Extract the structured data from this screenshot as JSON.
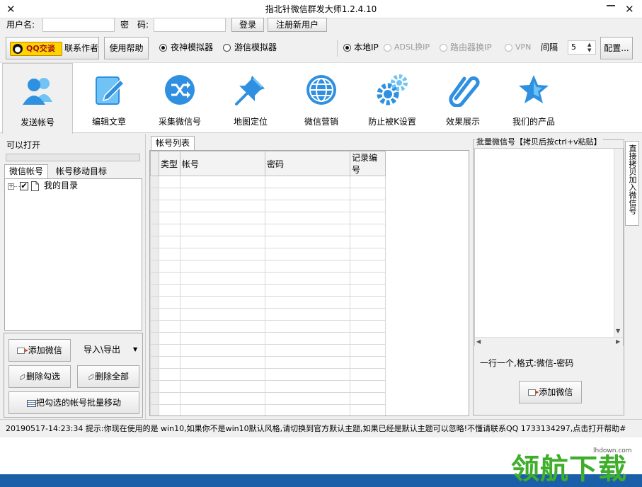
{
  "window": {
    "title": "指北针微信群发大师1.2.4.10"
  },
  "login": {
    "username_label": "用户名:",
    "password_label": "密　码:",
    "username_value": "",
    "password_value": "",
    "login_button": "登录",
    "register_button": "注册新用户"
  },
  "options": {
    "qq_button": "QQ交谈",
    "contact_author": "联系作者",
    "help_button": "使用帮助",
    "emulators": [
      {
        "label": "夜神模拟器",
        "selected": true
      },
      {
        "label": "游信模拟器",
        "selected": false
      }
    ],
    "ip_modes": [
      {
        "label": "本地IP",
        "selected": true,
        "enabled": true
      },
      {
        "label": "ADSL换IP",
        "selected": false,
        "enabled": false
      },
      {
        "label": "路由器换IP",
        "selected": false,
        "enabled": false
      },
      {
        "label": "VPN",
        "selected": false,
        "enabled": false
      }
    ],
    "interval_label": "间隔",
    "interval_value": "5",
    "config_button": "配置..."
  },
  "toolbar": {
    "items": [
      {
        "label": "发送帐号",
        "icon": "users-icon",
        "active": true
      },
      {
        "label": "编辑文章",
        "icon": "edit-icon",
        "active": false
      },
      {
        "label": "采集微信号",
        "icon": "shuffle-icon",
        "active": false
      },
      {
        "label": "地图定位",
        "icon": "pushpin-icon",
        "active": false
      },
      {
        "label": "微信营销",
        "icon": "globe-icon",
        "active": false
      },
      {
        "label": "防止被K设置",
        "icon": "gears-icon",
        "active": false
      },
      {
        "label": "效果展示",
        "icon": "paperclip-icon",
        "active": false
      },
      {
        "label": "我们的产品",
        "icon": "star-icon",
        "active": false
      }
    ]
  },
  "left_panel": {
    "can_open_label": "可以打开",
    "tabs": [
      "微信帐号",
      "帐号移动目标"
    ],
    "tree_root": "我的目录",
    "add_wechat_button": "添加微信",
    "import_export_button": "导入\\导出",
    "delete_checked_button": "删除勾选",
    "delete_all_button": "删除全部",
    "batch_move_button": "把勾选的帐号批量移动"
  },
  "grid": {
    "tab": "帐号列表",
    "columns": [
      "类型",
      "帐号",
      "密码",
      "记录编号"
    ]
  },
  "right_panel": {
    "title": "批量微信号【拷贝后按ctrl+v粘贴】",
    "hint": "一行一个,格式:微信-密码",
    "add_button": "添加微信",
    "side_tab": "直接拷贝加入微信号"
  },
  "status_bar": {
    "text": "20190517-14:23:34  提示:你现在使用的是 win10,如果你不是win10默认风格,请切换到官方默认主题,如果已经是默认主题可以忽略!不懂请联系QQ 1733134297,点击打开帮助#"
  },
  "watermark": {
    "text": "领航下载",
    "url_text": "lhdown.com"
  },
  "colors": {
    "accent_blue": "#2f8fe0",
    "icon_light": "#6fc3f5",
    "taskbar": "#1a5fa8",
    "watermark_green": "#3fae2a"
  }
}
